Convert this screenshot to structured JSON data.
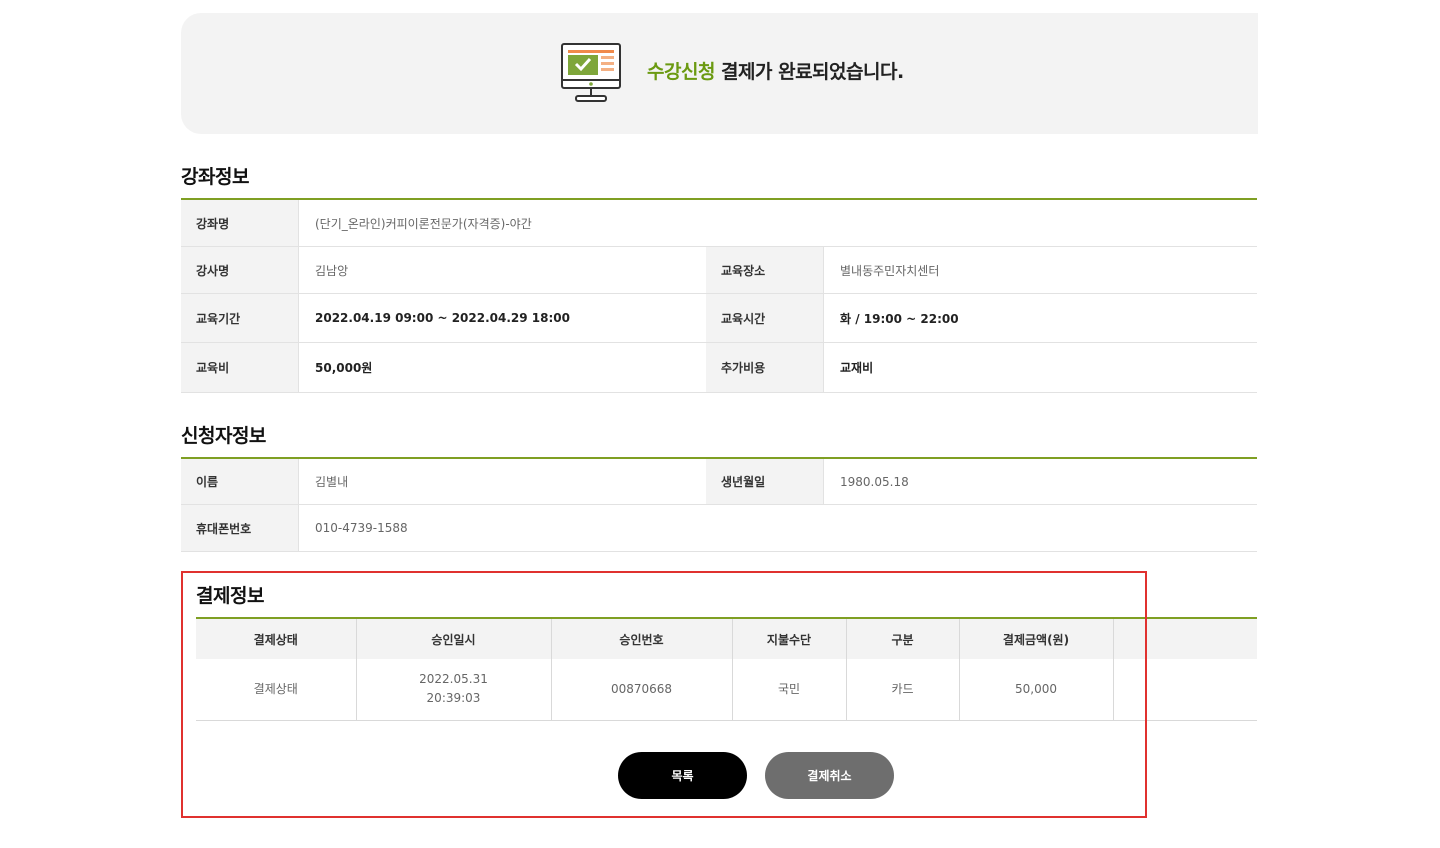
{
  "banner": {
    "accent_text": "수강신청",
    "message": " 결제가 완료되었습니다."
  },
  "course_info": {
    "title": "강좌정보",
    "course_name_label": "강좌명",
    "course_name": "(단기_온라인)커피이론전문가(자격증)-야간",
    "instructor_label": "강사명",
    "instructor": "김남앙",
    "location_label": "교육장소",
    "location": "별내동주민자치센터",
    "period_label": "교육기간",
    "period": "2022.04.19 09:00 ~ 2022.04.29 18:00",
    "time_label": "교육시간",
    "time": "화 / 19:00 ~ 22:00",
    "fee_label": "교육비",
    "fee": "50,000원",
    "extra_cost_label": "추가비용",
    "extra_cost": "교재비"
  },
  "applicant_info": {
    "title": "신청자정보",
    "name_label": "이름",
    "name": "김별내",
    "birth_label": "생년월일",
    "birth": "1980.05.18",
    "phone_label": "휴대폰번호",
    "phone": "010-4739-1588"
  },
  "payment_info": {
    "title": "결제정보",
    "headers": [
      "결제상태",
      "승인일시",
      "승인번호",
      "지불수단",
      "구분",
      "결제금액(원)",
      ""
    ],
    "row": {
      "status": "결제상태",
      "approval_date": "2022.05.31",
      "approval_time": "20:39:03",
      "approval_no": "00870668",
      "method": "국민",
      "type": "카드",
      "amount": "50,000",
      "extra": ""
    }
  },
  "buttons": {
    "list": "목록",
    "cancel": "결제취소"
  },
  "colors": {
    "accent": "#6b9a11",
    "rule": "#7f9f23",
    "highlight_border": "#e0312f"
  }
}
